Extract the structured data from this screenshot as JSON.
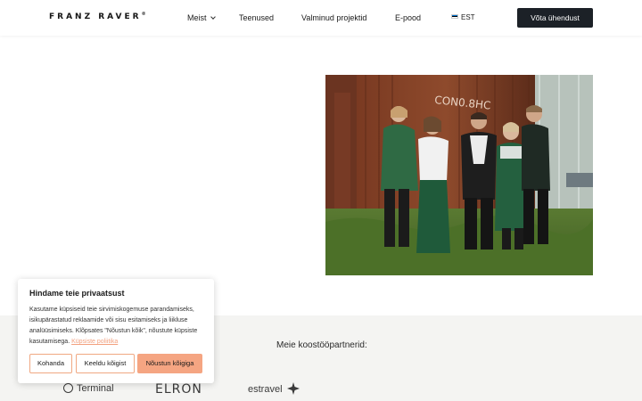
{
  "header": {
    "logo": "FRANZ RAVER",
    "logo_mark": "®",
    "nav": [
      {
        "label": "Meist",
        "has_dropdown": true
      },
      {
        "label": "Teenused",
        "has_dropdown": false
      },
      {
        "label": "Valminud projektid",
        "has_dropdown": false
      },
      {
        "label": "E-pood",
        "has_dropdown": false
      }
    ],
    "language": "EST",
    "cta_label": "Võta ühendust"
  },
  "hero": {
    "photo_text": "CON0.8HC"
  },
  "partners": {
    "title": "Meie koostööpartnerid:",
    "logos": [
      "Terminal",
      "ELRON",
      "estravel"
    ]
  },
  "cookie": {
    "title": "Hindame teie privaatsust",
    "body": "Kasutame küpsiseid teie sirvimiskogemuse parandamiseks, isikupärastatud reklaamide või sisu esitamiseks ja liikluse analüüsimiseks. Klõpsates \"Nõustun kõik\", nõustute küpsiste kasutamisega.",
    "policy_link": "Küpsiste poliitika",
    "buttons": {
      "customize": "Kohanda",
      "reject": "Keeldu kõigist",
      "accept": "Nõustun kõigiga"
    }
  },
  "colors": {
    "cta_bg": "#1c2127",
    "accent": "#f5a582",
    "partners_bg": "#f4f4f2"
  }
}
